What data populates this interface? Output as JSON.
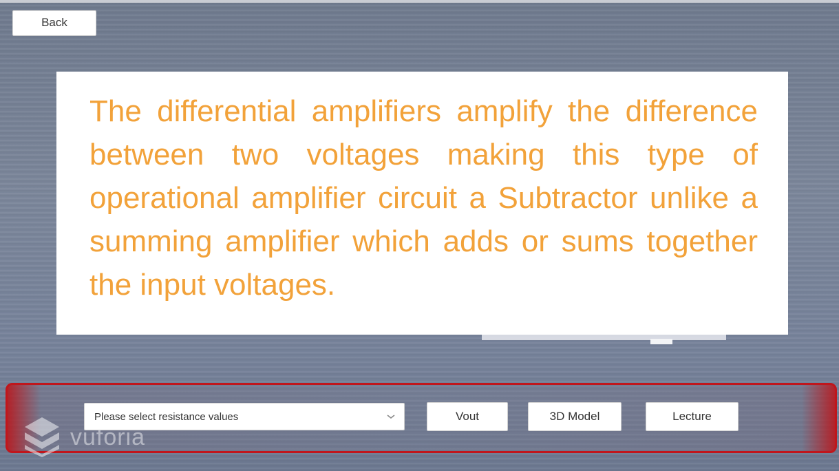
{
  "header": {
    "back_label": "Back"
  },
  "panel": {
    "text": "The differential amplifiers amplify the difference between two voltages making this type of operational amplifier circuit a Subtractor unlike a summing amplifier which adds or sums together the input voltages."
  },
  "toolbar": {
    "dropdown_value": "Please select resistance values",
    "vout_label": "Vout",
    "model_label": "3D Model",
    "lecture_label": "Lecture"
  },
  "watermark": {
    "text": "vuforia",
    "icon": "vuforia-logo-icon"
  },
  "colors": {
    "text_orange": "#f2a23a",
    "bar_border": "#c0161c",
    "panel_bg": "#ffffff"
  }
}
